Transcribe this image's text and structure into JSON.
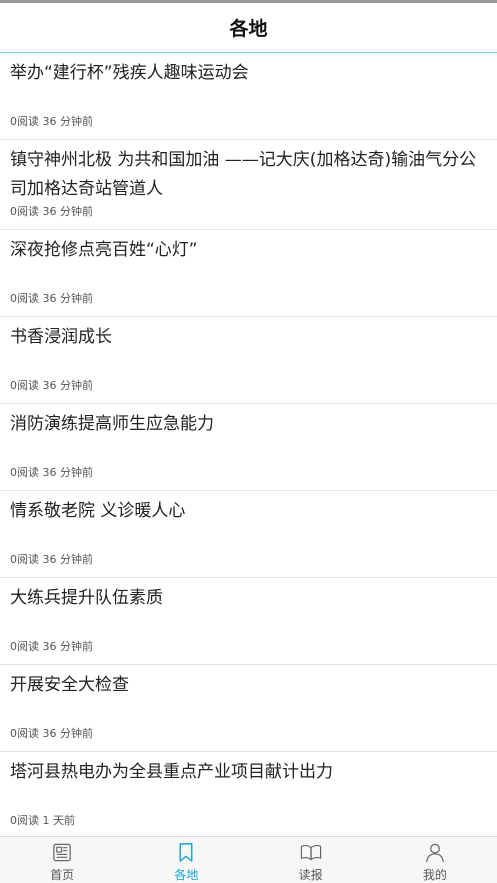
{
  "header": {
    "title": "各地"
  },
  "articles": [
    {
      "headline": "举办“建行杯”残疾人趣味运动会",
      "meta": "0阅读 36 分钟前"
    },
    {
      "headline": "镇守神州北极 为共和国加油 ——记大庆(加格达奇)输油气分公司加格达奇站管道人",
      "meta": "0阅读 36 分钟前"
    },
    {
      "headline": "深夜抢修点亮百姓“心灯”",
      "meta": "0阅读 36 分钟前"
    },
    {
      "headline": "书香浸润成长",
      "meta": "0阅读 36 分钟前"
    },
    {
      "headline": "消防演练提高师生应急能力",
      "meta": "0阅读 36 分钟前"
    },
    {
      "headline": "情系敬老院 义诊暖人心",
      "meta": "0阅读 36 分钟前"
    },
    {
      "headline": "大练兵提升队伍素质",
      "meta": "0阅读 36 分钟前"
    },
    {
      "headline": "开展安全大检查",
      "meta": "0阅读 36 分钟前"
    },
    {
      "headline": "塔河县热电办为全县重点产业项目献计出力",
      "meta": "0阅读 1 天前"
    }
  ],
  "tabbar": {
    "accent_color": "#18a4d6",
    "tabs": [
      {
        "label": "首页",
        "icon": "newspaper-icon",
        "active": false
      },
      {
        "label": "各地",
        "icon": "bookmark-icon",
        "active": true
      },
      {
        "label": "读报",
        "icon": "open-book-icon",
        "active": false
      },
      {
        "label": "我的",
        "icon": "person-icon",
        "active": false
      }
    ]
  }
}
